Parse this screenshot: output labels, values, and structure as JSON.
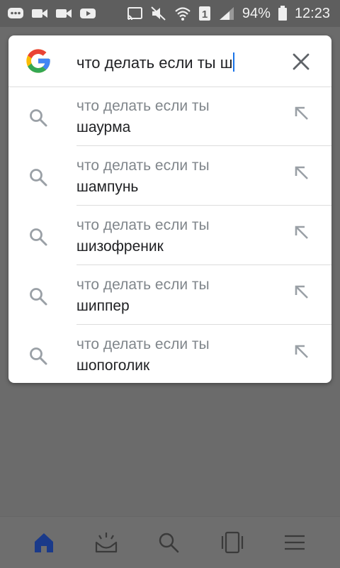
{
  "status_bar": {
    "battery_percent": "94%",
    "time": "12:23",
    "sim_slot": "1",
    "icons_left": [
      "chat-icon",
      "video-camera-icon",
      "video-camera-icon",
      "youtube-icon"
    ],
    "icons_right": [
      "cast-icon",
      "mute-icon",
      "wifi-icon",
      "sim-icon",
      "signal-icon",
      "battery-icon"
    ]
  },
  "search": {
    "query": "что делать если ты ш",
    "logo": "google-g-logo",
    "clear_icon": "close-icon"
  },
  "suggestions": [
    {
      "prefix": "что делать если ты",
      "completion": "шаурма"
    },
    {
      "prefix": "что делать если ты",
      "completion": "шампунь"
    },
    {
      "prefix": "что делать если ты",
      "completion": "шизофреник"
    },
    {
      "prefix": "что делать если ты",
      "completion": "шиппер"
    },
    {
      "prefix": "что делать если ты",
      "completion": "шопоголик"
    }
  ],
  "bottom_nav": [
    {
      "icon": "home-icon",
      "active": true
    },
    {
      "icon": "discover-icon",
      "active": false
    },
    {
      "icon": "search-icon",
      "active": false
    },
    {
      "icon": "tabs-icon",
      "active": false
    },
    {
      "icon": "menu-icon",
      "active": false
    }
  ],
  "colors": {
    "scrim": "#6b6b6b",
    "card": "#ffffff",
    "active_nav": "#1a3a8a",
    "google_blue": "#4285F4",
    "google_red": "#EA4335",
    "google_yellow": "#FBBC05",
    "google_green": "#34A853"
  }
}
